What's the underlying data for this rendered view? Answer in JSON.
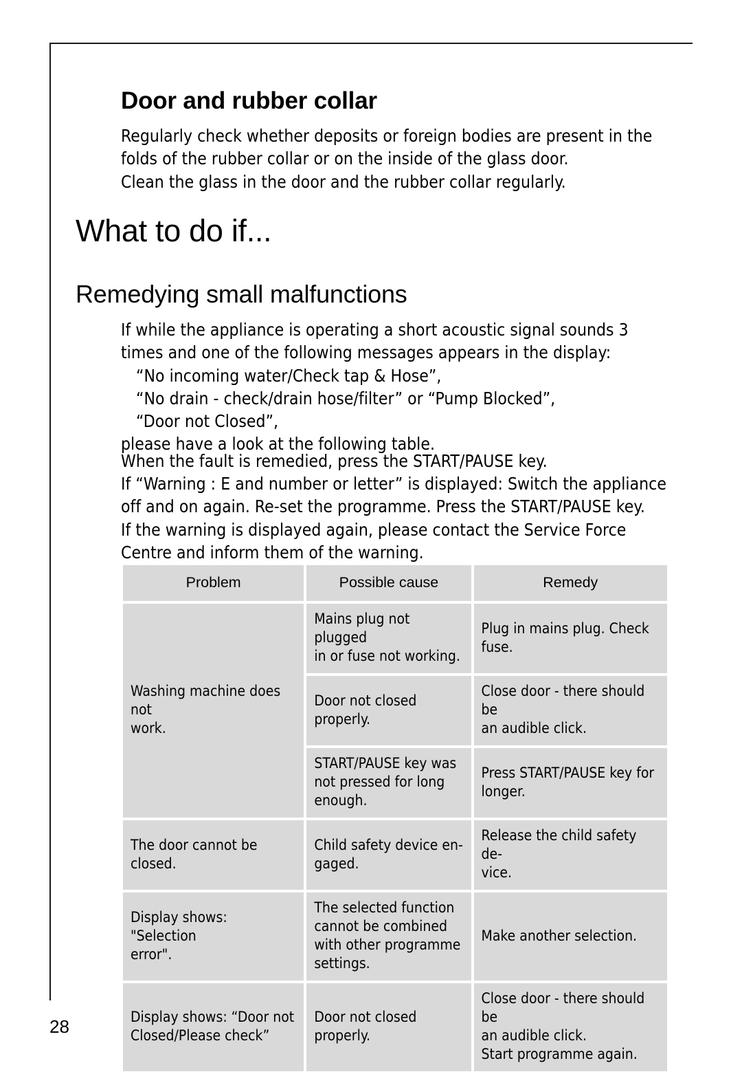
{
  "page": {
    "number": "28",
    "frame_color": "#1a1a1a",
    "table_cell_color": "#d9d9d9"
  },
  "sections": {
    "door_collar": {
      "heading": "Door and rubber collar",
      "body": "Regularly check whether deposits or foreign bodies are present in the\nfolds of the rubber collar or on the inside of the glass door.\nClean the glass in the door and the rubber collar regularly."
    },
    "chapter": {
      "title": "What to do if..."
    },
    "remedying": {
      "heading": "Remedying small malfunctions",
      "intro": "If while the appliance is operating a short acoustic signal sounds 3\ntimes and one of the following messages appears in the display:",
      "message_1": "“No incoming water/Check tap & Hose”,",
      "message_2": "“No drain - check/drain hose/filter” or “Pump Blocked”,",
      "message_3": "“Door not Closed”,",
      "table_ref": "please have a look at the following table.",
      "fault_note": "When the fault is remedied, press the START/PAUSE key.",
      "warning_note": "If “Warning : E and number or letter” is displayed: Switch the appliance\noff and on again. Re-set the programme. Press the START/PAUSE key.",
      "service_note": "If the warning is displayed again, please contact the Service Force\nCentre and inform them of the warning."
    }
  },
  "troubleshooting_table": {
    "headers": [
      "Problem",
      "Possible cause",
      "Remedy"
    ],
    "rows": [
      {
        "problem": "Washing machine does not\nwork.",
        "problem_rowspan": 3,
        "cause": "Mains plug not plugged\nin or fuse not working.",
        "remedy": "Plug in mains plug. Check\nfuse."
      },
      {
        "cause": "Door not closed properly.",
        "remedy": "Close door - there should be\nan audible click."
      },
      {
        "cause": "START/PAUSE key was\nnot pressed for long\nenough.",
        "remedy": "Press START/PAUSE key for\nlonger."
      },
      {
        "problem": "The door cannot be closed.",
        "problem_rowspan": 1,
        "cause": "Child safety device en-\ngaged.",
        "remedy": "Release the child safety de-\nvice."
      },
      {
        "problem": "Display shows: \"Selection\nerror\".",
        "problem_rowspan": 1,
        "cause": "The selected function\ncannot be combined\nwith other programme\nsettings.",
        "remedy": "Make another selection."
      },
      {
        "problem": "Display shows: “Door not\nClosed/Please check”",
        "problem_rowspan": 1,
        "cause": "Door not closed properly.",
        "remedy": "Close door - there should be\nan audible click.\nStart programme again."
      }
    ]
  }
}
